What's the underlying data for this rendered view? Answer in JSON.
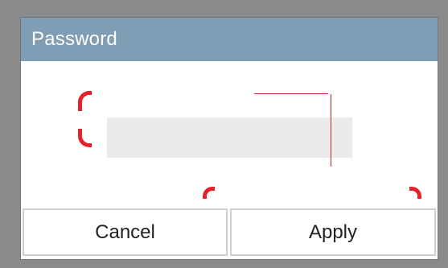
{
  "dialog": {
    "title": "Password",
    "password_value": "",
    "cancel_label": "Cancel",
    "apply_label": "Apply"
  },
  "colors": {
    "title_bar": "#7f9db4",
    "field_bg": "#ebebeb",
    "annotation": "#e8202a"
  }
}
